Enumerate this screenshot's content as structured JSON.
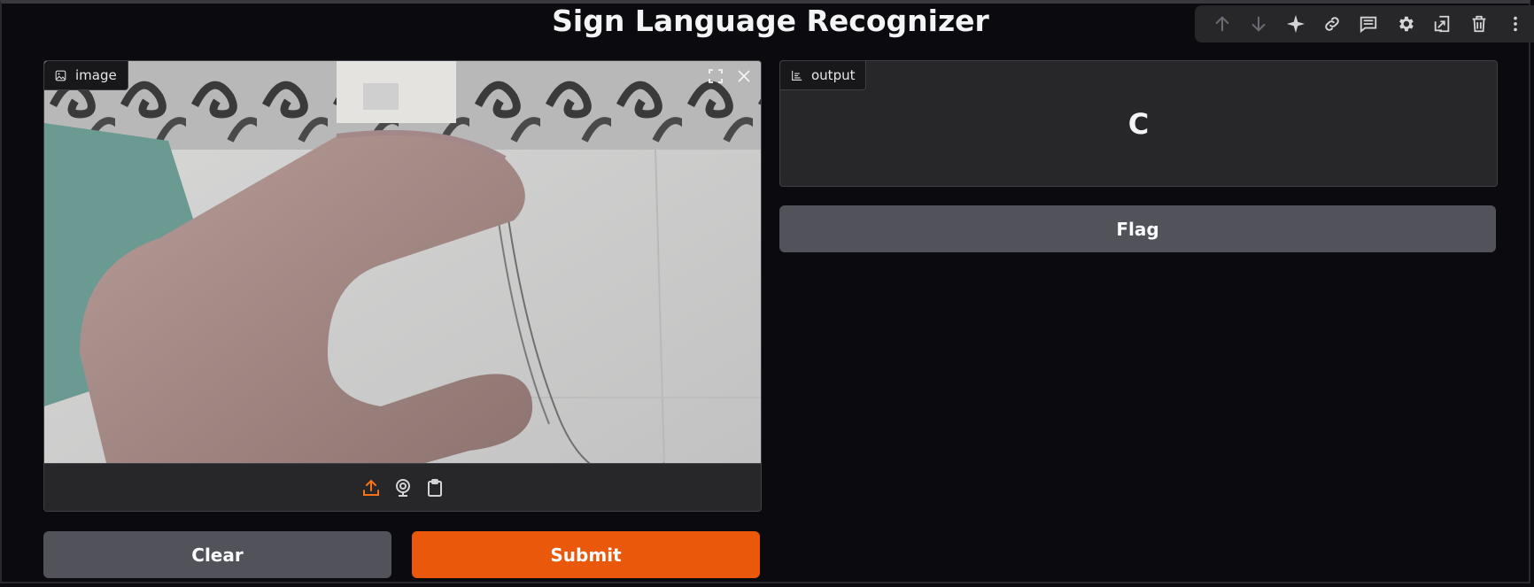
{
  "app": {
    "title": "Sign Language Recognizer"
  },
  "toolbar": {
    "icons": [
      "arrow-up-icon",
      "arrow-down-icon",
      "sparkle-icon",
      "link-icon",
      "comment-icon",
      "gear-icon",
      "export-icon",
      "trash-icon",
      "more-vertical-icon"
    ]
  },
  "input": {
    "label": "image",
    "image_description_icon": "image-icon",
    "sources": [
      "upload-icon",
      "webcam-icon",
      "clipboard-icon"
    ],
    "active_source": "upload"
  },
  "output": {
    "label": "output",
    "value": "C"
  },
  "buttons": {
    "flag": "Flag",
    "clear": "Clear",
    "submit": "Submit"
  },
  "colors": {
    "background": "#0b0b0f",
    "panel": "#27272a",
    "secondary_button": "#52525b",
    "primary_button": "#ea580c",
    "accent_icon": "#f97316"
  }
}
